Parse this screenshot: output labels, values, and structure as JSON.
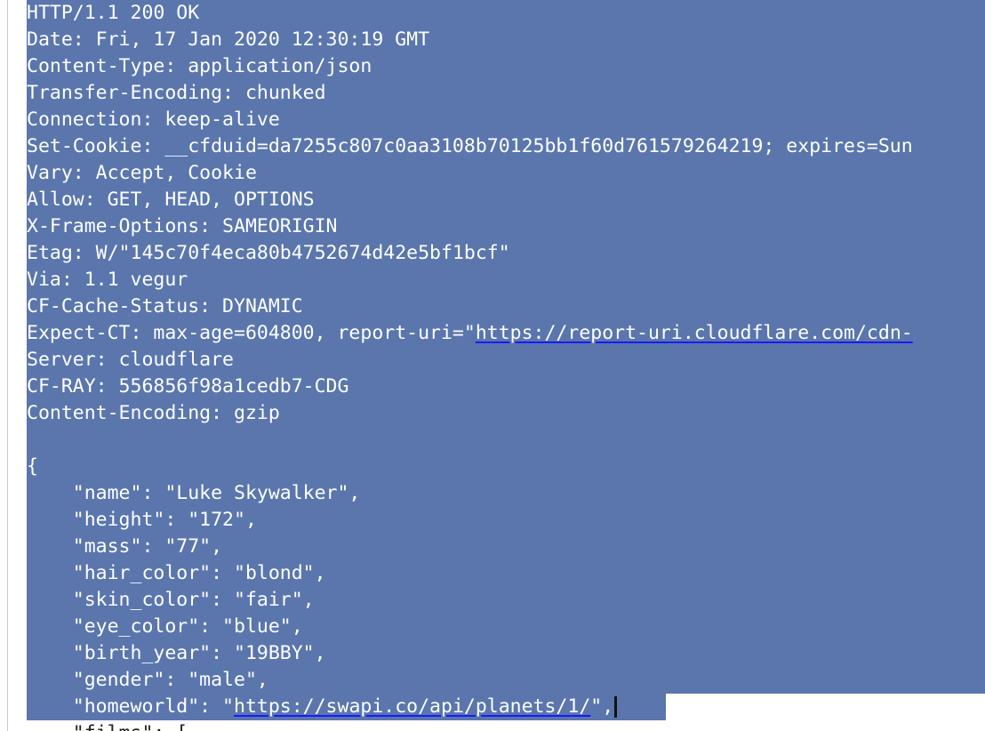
{
  "headers": [
    "HTTP/1.1 200 OK",
    "Date: Fri, 17 Jan 2020 12:30:19 GMT",
    "Content-Type: application/json",
    "Transfer-Encoding: chunked",
    "Connection: keep-alive",
    "Set-Cookie: __cfduid=da7255c807c0aa3108b70125bb1f60d761579264219; expires=Sun",
    "Vary: Accept, Cookie",
    "Allow: GET, HEAD, OPTIONS",
    "X-Frame-Options: SAMEORIGIN",
    "Etag: W/\"145c70f4eca80b4752674d42e5bf1bcf\"",
    "Via: 1.1 vegur",
    "CF-Cache-Status: DYNAMIC"
  ],
  "expect_ct": {
    "prefix": "Expect-CT: max-age=604800, report-uri=\"",
    "link": "https://report-uri.cloudflare.com/cdn-"
  },
  "headers_after": [
    "Server: cloudflare",
    "CF-RAY: 556856f98a1cedb7-CDG",
    "Content-Encoding: gzip"
  ],
  "body": {
    "open_brace": "{",
    "fields": [
      "    \"name\": \"Luke Skywalker\",",
      "    \"height\": \"172\",",
      "    \"mass\": \"77\",",
      "    \"hair_color\": \"blond\",",
      "    \"skin_color\": \"fair\",",
      "    \"eye_color\": \"blue\",",
      "    \"birth_year\": \"19BBY\",",
      "    \"gender\": \"male\","
    ],
    "homeworld": {
      "prefix": "    \"homeworld\": \"",
      "link": "https://swapi.co/api/planets/1/",
      "suffix": "\","
    },
    "cut_line": "    \"films\": ["
  },
  "colors": {
    "selection": "#5a76ad",
    "text": "#ffffff",
    "link_underline": "#1a1aff"
  }
}
